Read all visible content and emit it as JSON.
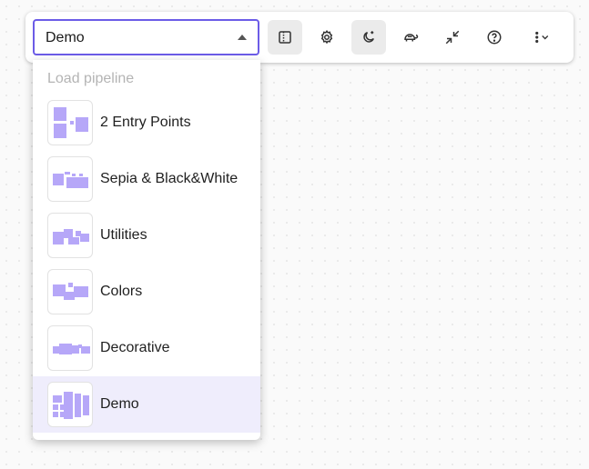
{
  "toolbar": {
    "pipeline_select": {
      "value": "Demo"
    },
    "buttons": [
      {
        "name": "sidebar-toggle-icon",
        "active": true
      },
      {
        "name": "gear-icon",
        "active": false
      },
      {
        "name": "moon-icon",
        "active": true
      },
      {
        "name": "turtle-icon",
        "active": false
      },
      {
        "name": "minimize-icon",
        "active": false
      },
      {
        "name": "help-icon",
        "active": false
      },
      {
        "name": "more-menu-icon",
        "active": false
      }
    ]
  },
  "dropdown": {
    "header": "Load pipeline",
    "items": [
      {
        "label": "2 Entry Points",
        "selected": false
      },
      {
        "label": "Sepia & Black&White",
        "selected": false
      },
      {
        "label": "Utilities",
        "selected": false
      },
      {
        "label": "Colors",
        "selected": false
      },
      {
        "label": "Decorative",
        "selected": false
      },
      {
        "label": "Demo",
        "selected": true
      }
    ]
  },
  "colors": {
    "accent": "#6c5ce7",
    "thumbnail_fill": "#b6a7f8",
    "selected_bg": "#efedfc"
  }
}
